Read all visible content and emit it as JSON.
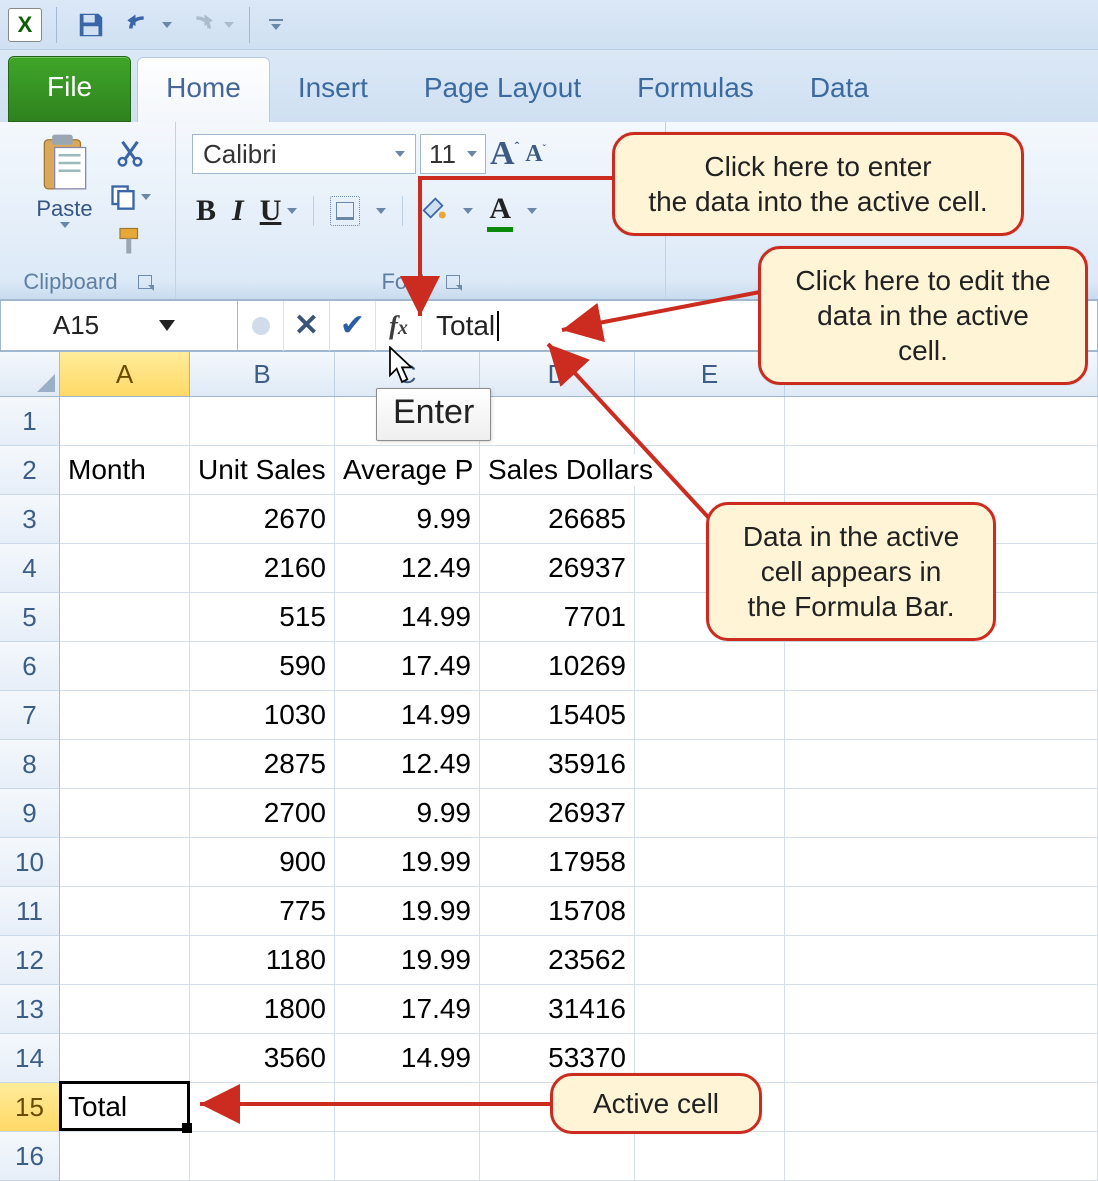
{
  "qat": {
    "app": "X"
  },
  "tabs": {
    "file": "File",
    "items": [
      "Home",
      "Insert",
      "Page Layout",
      "Formulas",
      "Data"
    ],
    "active_index": 0
  },
  "ribbon": {
    "clipboard": {
      "paste": "Paste",
      "label": "Clipboard"
    },
    "font": {
      "name": "Calibri",
      "size": "11",
      "label": "Font",
      "bold": "B",
      "italic": "I",
      "underline": "U",
      "color_letter": "A"
    }
  },
  "formula_bar": {
    "name_box": "A15",
    "input": "Total",
    "tooltip": "Enter"
  },
  "columns": [
    "A",
    "B",
    "C",
    "D",
    "E"
  ],
  "row_headers": [
    "1",
    "2",
    "3",
    "4",
    "5",
    "6",
    "7",
    "8",
    "9",
    "10",
    "11",
    "12",
    "13",
    "14",
    "15",
    "16"
  ],
  "headers": {
    "A": "Month",
    "B": "Unit Sales",
    "C": "Average P",
    "C_full": "Average P",
    "D": "Sales Dollars"
  },
  "data_rows": [
    {
      "b": "2670",
      "c": "9.99",
      "d": "26685"
    },
    {
      "b": "2160",
      "c": "12.49",
      "d": "26937"
    },
    {
      "b": "515",
      "c": "14.99",
      "d": "7701"
    },
    {
      "b": "590",
      "c": "17.49",
      "d": "10269"
    },
    {
      "b": "1030",
      "c": "14.99",
      "d": "15405"
    },
    {
      "b": "2875",
      "c": "12.49",
      "d": "35916"
    },
    {
      "b": "2700",
      "c": "9.99",
      "d": "26937"
    },
    {
      "b": "900",
      "c": "19.99",
      "d": "17958"
    },
    {
      "b": "775",
      "c": "19.99",
      "d": "15708"
    },
    {
      "b": "1180",
      "c": "19.99",
      "d": "23562"
    },
    {
      "b": "1800",
      "c": "17.49",
      "d": "31416"
    },
    {
      "b": "3560",
      "c": "14.99",
      "d": "53370"
    }
  ],
  "active_cell_value": "Total",
  "callouts": {
    "enter": "Click here to enter\nthe data into the active cell.",
    "edit": "Click here to edit the\ndata in the active cell.",
    "fb": "Data in the active\ncell appears in\nthe Formula Bar.",
    "active": "Active cell"
  }
}
